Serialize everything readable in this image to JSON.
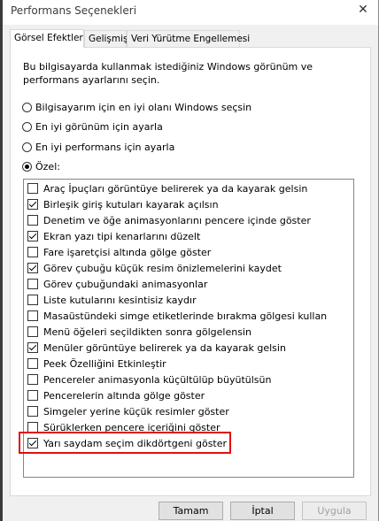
{
  "window": {
    "title": "Performans Seçenekleri",
    "close_label": "✕"
  },
  "tabs": [
    {
      "label": "Görsel Efektler",
      "active": true
    },
    {
      "label": "Gelişmiş",
      "active": false
    },
    {
      "label": "Veri Yürütme Engellemesi",
      "active": false
    }
  ],
  "intro_text": "Bu bilgisayarda kullanmak istediğiniz Windows görünüm ve performans ayarlarını seçin.",
  "radios": [
    {
      "label": "Bilgisayarım için en iyi olanı Windows seçsin",
      "checked": false
    },
    {
      "label": "En iyi görünüm için ayarla",
      "checked": false
    },
    {
      "label": "En iyi performans için ayarla",
      "checked": false
    },
    {
      "label": "Özel:",
      "checked": true
    }
  ],
  "options": [
    {
      "label": "Araç İpuçları görüntüye belirerek ya da kayarak gelsin",
      "checked": false
    },
    {
      "label": "Birleşik giriş kutuları kayarak açılsın",
      "checked": true
    },
    {
      "label": "Denetim ve öğe animasyonlarını pencere içinde göster",
      "checked": false
    },
    {
      "label": "Ekran yazı tipi kenarlarını düzelt",
      "checked": true
    },
    {
      "label": "Fare işaretçisi altında gölge göster",
      "checked": false
    },
    {
      "label": "Görev çubuğu küçük resim önizlemelerini kaydet",
      "checked": true
    },
    {
      "label": "Görev çubuğundaki animasyonlar",
      "checked": false
    },
    {
      "label": "Liste kutularını kesintisiz kaydır",
      "checked": false
    },
    {
      "label": "Masaüstündeki simge etiketlerinde bırakma gölgesi kullan",
      "checked": false
    },
    {
      "label": "Menü öğeleri seçildikten sonra gölgelensin",
      "checked": false
    },
    {
      "label": "Menüler görüntüye belirerek ya da kayarak gelsin",
      "checked": true
    },
    {
      "label": "Peek Özelliğini Etkinleştir",
      "checked": false
    },
    {
      "label": "Pencereler animasyonla küçültülüp büyütülsün",
      "checked": false
    },
    {
      "label": "Pencerelerin altında gölge göster",
      "checked": false
    },
    {
      "label": "Simgeler yerine küçük resimler göster",
      "checked": false
    },
    {
      "label": "Sürüklerken pencere içeriğini göster",
      "checked": false
    },
    {
      "label": "Yarı saydam seçim dikdörtgeni göster",
      "checked": true
    }
  ],
  "buttons": {
    "ok": "Tamam",
    "cancel": "İptal",
    "apply": "Uygula"
  },
  "colors": {
    "highlight": "#e01010"
  }
}
